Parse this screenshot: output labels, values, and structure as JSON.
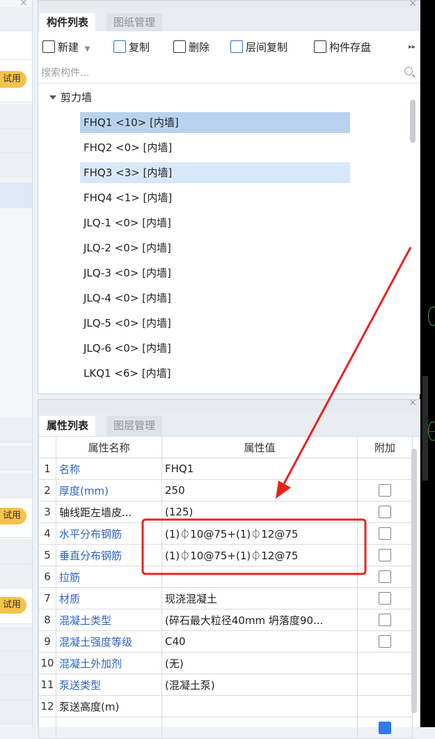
{
  "component_panel": {
    "tabs": [
      {
        "label": "构件列表"
      },
      {
        "label": "图纸管理"
      }
    ],
    "toolbar": {
      "new": "新建",
      "copy": "复制",
      "delete": "删除",
      "floor_copy": "层间复制",
      "save": "构件存盘"
    },
    "search_placeholder": "搜索构件...",
    "group": "剪力墙",
    "items": [
      "FHQ1 <10> [内墙]",
      "FHQ2 <0> [内墙]",
      "FHQ3 <3> [内墙]",
      "FHQ4 <1> [内墙]",
      "JLQ-1 <0> [内墙]",
      "JLQ-2 <0> [内墙]",
      "JLQ-3 <0> [内墙]",
      "JLQ-4 <0> [内墙]",
      "JLQ-5 <0> [内墙]",
      "JLQ-6 <0> [内墙]",
      "LKQ1 <6> [内墙]"
    ]
  },
  "property_panel": {
    "tabs": [
      {
        "label": "属性列表"
      },
      {
        "label": "图层管理"
      }
    ],
    "columns": {
      "name": "属性名称",
      "value": "属性值",
      "extra": "附加"
    },
    "rows": [
      {
        "num": "1",
        "name": "名称",
        "value": "FHQ1"
      },
      {
        "num": "2",
        "name": "厚度(mm)",
        "value": "250"
      },
      {
        "num": "3",
        "name": "轴线距左墙皮...",
        "value": "(125)"
      },
      {
        "num": "4",
        "name": "水平分布钢筋",
        "value": "(1)⏀10@75+(1)⏀12@75"
      },
      {
        "num": "5",
        "name": "垂直分布钢筋",
        "value": "(1)⏀10@75+(1)⏀12@75"
      },
      {
        "num": "6",
        "name": "拉筋",
        "value": ""
      },
      {
        "num": "7",
        "name": "材质",
        "value": "现浇混凝土"
      },
      {
        "num": "8",
        "name": "混凝土类型",
        "value": "(碎石最大粒径40mm 坍落度90..."
      },
      {
        "num": "9",
        "name": "混凝土强度等级",
        "value": "C40"
      },
      {
        "num": "10",
        "name": "混凝土外加剂",
        "value": "(无)"
      },
      {
        "num": "11",
        "name": "泵送类型",
        "value": "(混凝土泵)"
      },
      {
        "num": "12",
        "name": "泵送高度(m)",
        "value": ""
      }
    ]
  },
  "left_strip": {
    "trial_badge": "试用"
  },
  "colors": {
    "accent": "#2c63c4",
    "selection": "#b9d3ee",
    "highlight_annotation": "#e8231f",
    "trial_badge": "#f6c24a"
  }
}
